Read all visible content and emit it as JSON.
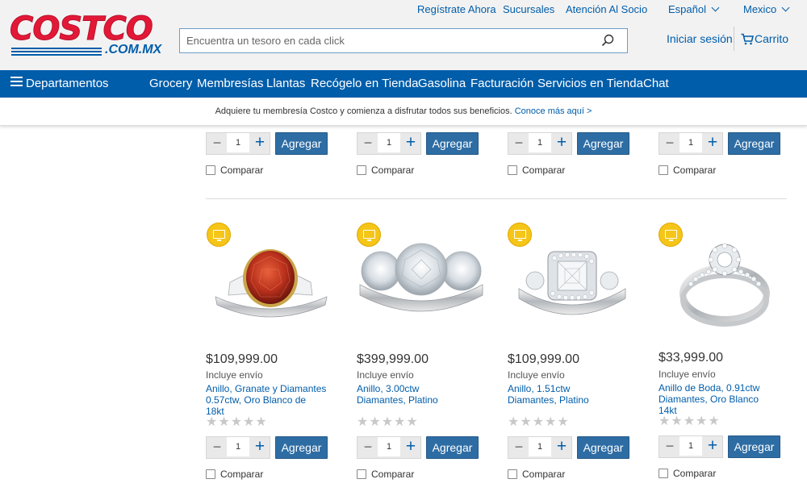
{
  "brand": {
    "logo_main": "COSTCO",
    "logo_sub": ".COM.MX",
    "colors": {
      "red": "#e31837",
      "blue": "#005daa",
      "button": "#2e6da4"
    }
  },
  "top_links": {
    "register": "Regístrate Ahora",
    "stores": "Sucursales",
    "support": "Atención Al Socio",
    "language": "Español",
    "country": "Mexico"
  },
  "search": {
    "placeholder": "Encuentra un tesoro en cada click",
    "icon": "search-icon"
  },
  "account": {
    "signin": "Iniciar sesión",
    "cart": "Carrito"
  },
  "nav": {
    "departments": "Departamentos",
    "items": [
      "Grocery",
      "Membresías",
      "Llantas",
      "Recógelo en Tienda",
      "Gasolina",
      "Facturación",
      "Servicios en Tienda",
      "Chat"
    ]
  },
  "promo": {
    "text": "Adquiere tu membresía Costco y comienza a disfrutar todos sus beneficios.",
    "link": "Conoce más aquí >"
  },
  "common": {
    "qty": "1",
    "minus": "−",
    "plus": "+",
    "add": "Agregar",
    "compare": "Comparar",
    "stars": "★★★★★"
  },
  "products": [
    {
      "price": "$109,999.00",
      "shipping": "Incluye envío",
      "title": "Anillo, Granate y Diamantes 0.57ctw, Oro Blanco de 18kt",
      "rating": 0
    },
    {
      "price": "$399,999.00",
      "shipping": "Incluye envío",
      "title": "Anillo, 3.00ctw Diamantes, Platino",
      "rating": 0
    },
    {
      "price": "$109,999.00",
      "shipping": "Incluye envío",
      "title": "Anillo, 1.51ctw Diamantes, Platino",
      "rating": 0
    },
    {
      "price": "$33,999.00",
      "shipping": "Incluye envío",
      "title": "Anillo de Boda, 0.91ctw Diamantes, Oro Blanco 14kt",
      "rating": 0
    }
  ]
}
